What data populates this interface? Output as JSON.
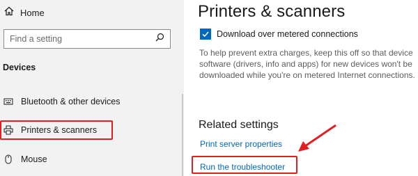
{
  "sidebar": {
    "home_label": "Home",
    "search_placeholder": "Find a setting",
    "section_title": "Devices",
    "items": [
      {
        "label": "Bluetooth & other devices",
        "icon": "bluetooth-keyboard-icon"
      },
      {
        "label": "Printers & scanners",
        "icon": "printer-icon",
        "selected": true
      },
      {
        "label": "Mouse",
        "icon": "mouse-icon"
      }
    ]
  },
  "main": {
    "title": "Printers & scanners",
    "checkbox": {
      "label": "Download over metered connections",
      "checked": true
    },
    "help_lines": [
      "To help prevent extra charges, keep this off so that device",
      "software (drivers, info and apps) for new devices won't be",
      "downloaded while you're on metered Internet connections."
    ],
    "related_title": "Related settings",
    "links": [
      "Print server properties",
      "Run the troubleshooter"
    ]
  },
  "colors": {
    "accent": "#0067c0",
    "annotation": "#e02020"
  }
}
